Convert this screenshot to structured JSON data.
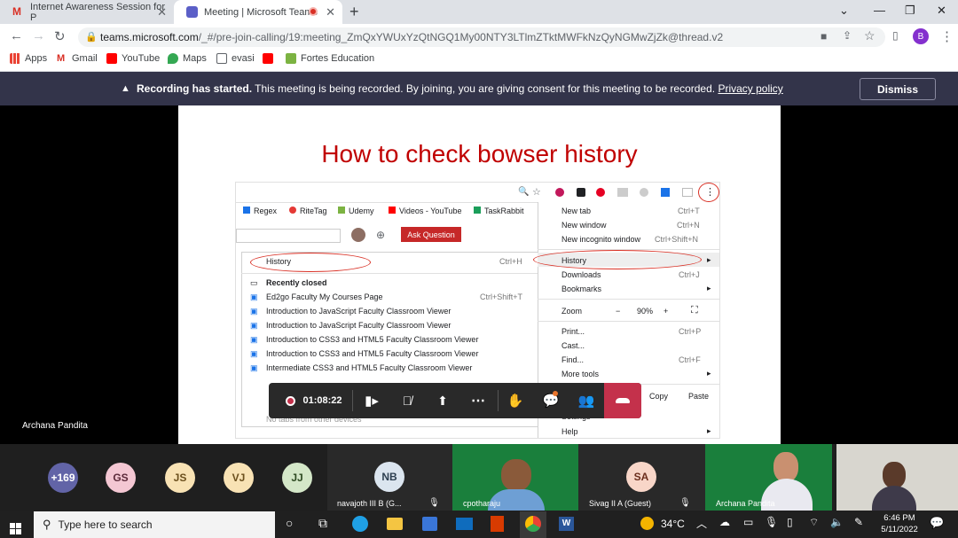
{
  "browser": {
    "tabs": [
      {
        "title": "Internet Awareness Session for P",
        "favicon": "gmail-icon"
      },
      {
        "title": "Meeting | Microsoft Teams",
        "favicon": "teams-icon"
      }
    ],
    "url_host": "teams.microsoft.com",
    "url_path": "/_#/pre-join-calling/19:meeting_ZmQxYWUxYzQtNGQ1My00NTY3LTlmZTktMWFkNzQyNGMwZjZk@thread.v2",
    "profile_initial": "B",
    "bookmarks": [
      "Apps",
      "Gmail",
      "YouTube",
      "Maps",
      "evasi",
      "Fortes Education"
    ]
  },
  "banner": {
    "bold": "Recording has started.",
    "text": " This meeting is being recorded. By joining, you are giving consent for this meeting to be recorded. ",
    "link": "Privacy policy",
    "dismiss": "Dismiss"
  },
  "slide": {
    "title": "How to check bowser history",
    "bookmarks": [
      "Regex",
      "RiteTag",
      "Udemy",
      "Videos - YouTube",
      "TaskRabbit"
    ],
    "ask_button": "Ask Question",
    "history_sub": {
      "history": "History",
      "history_shortcut": "Ctrl+H",
      "recently_closed": "Recently closed",
      "items": [
        {
          "label": "Ed2go Faculty My Courses Page",
          "shortcut": "Ctrl+Shift+T"
        },
        {
          "label": "Introduction to JavaScript Faculty Classroom Viewer",
          "shortcut": ""
        },
        {
          "label": "Introduction to JavaScript Faculty Classroom Viewer",
          "shortcut": ""
        },
        {
          "label": "Introduction to CSS3 and HTML5 Faculty Classroom Viewer",
          "shortcut": ""
        },
        {
          "label": "Introduction to CSS3 and HTML5 Faculty Classroom Viewer",
          "shortcut": ""
        },
        {
          "label": "Intermediate CSS3 and HTML5 Faculty Classroom Viewer",
          "shortcut": ""
        }
      ],
      "footer": "No tabs from other devices"
    },
    "chrome_menu": {
      "new_tab": "New tab",
      "new_tab_sc": "Ctrl+T",
      "new_window": "New window",
      "new_window_sc": "Ctrl+N",
      "incognito": "New incognito window",
      "incognito_sc": "Ctrl+Shift+N",
      "history": "History",
      "downloads": "Downloads",
      "downloads_sc": "Ctrl+J",
      "bookmarks": "Bookmarks",
      "zoom": "Zoom",
      "zoom_minus": "−",
      "zoom_value": "90%",
      "zoom_plus": "+",
      "print": "Print...",
      "print_sc": "Ctrl+P",
      "cast": "Cast...",
      "find": "Find...",
      "find_sc": "Ctrl+F",
      "more_tools": "More tools",
      "copy": "Copy",
      "paste": "Paste",
      "settings": "Settings",
      "help": "Help"
    }
  },
  "presenter": "Archana Pandita",
  "toolbar": {
    "timer": "01:08:22"
  },
  "participants": {
    "more_count": "+169",
    "initials": [
      {
        "text": "GS",
        "bg": "#f4c7d3"
      },
      {
        "text": "JS",
        "bg": "#f8e2b4"
      },
      {
        "text": "VJ",
        "bg": "#f8e2b4"
      },
      {
        "text": "JJ",
        "bg": "#d4e7c8"
      }
    ],
    "tiles": [
      {
        "initials": "NB",
        "name": "navajoth III B (G..."
      },
      {
        "initials": "",
        "name": "cpotharaju"
      },
      {
        "initials": "SA",
        "name": "Sivag II A (Guest)"
      },
      {
        "initials": "",
        "name": "Archana Pandita"
      }
    ]
  },
  "taskbar": {
    "search_placeholder": "Type here to search",
    "temperature": "34°C",
    "time": "6:46 PM",
    "date": "5/11/2022"
  }
}
